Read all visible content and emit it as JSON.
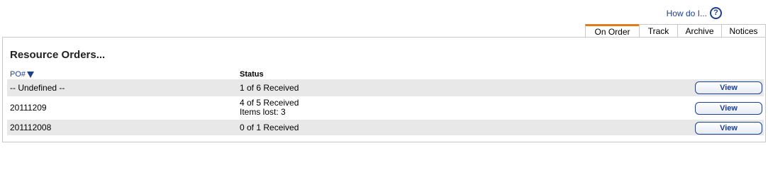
{
  "help": {
    "label": "How do I...",
    "icon": "?"
  },
  "tabs": [
    {
      "label": "On Order",
      "active": true
    },
    {
      "label": "Track",
      "active": false
    },
    {
      "label": "Archive",
      "active": false
    },
    {
      "label": "Notices",
      "active": false
    }
  ],
  "panel": {
    "title": "Resource Orders...",
    "columns": {
      "po": "PO#",
      "status": "Status"
    },
    "rows": [
      {
        "po": "-- Undefined --",
        "status": "1 of 6 Received",
        "status2": "",
        "action": "View"
      },
      {
        "po": "20111209",
        "status": "4 of 5 Received",
        "status2": "Items lost: 3",
        "action": "View"
      },
      {
        "po": "201112008",
        "status": "0 of 1 Received",
        "status2": "",
        "action": "View"
      }
    ]
  },
  "colors": {
    "accent": "#1f3f8f",
    "active_tab": "#e07b1c",
    "row_shade": "#e8e8e8"
  }
}
